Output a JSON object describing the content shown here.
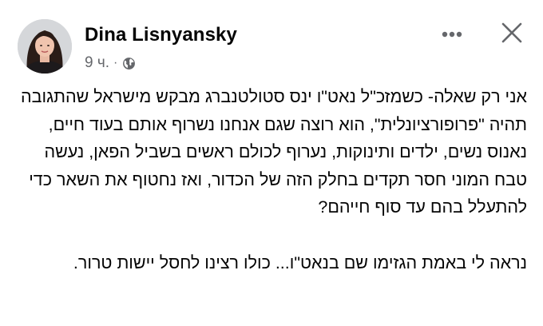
{
  "post": {
    "author": "Dina Lisnyansky",
    "time": "9 ч.",
    "separator": "·",
    "privacy_icon": "globe-icon",
    "menu_icon": "more-horizontal-icon",
    "close_icon": "close-icon",
    "paragraphs": [
      "אני רק שאלה- כשמזכ\"ל נאט\"ו ינס סטולטנברג מבקש מישראל שהתגובה תהיה \"פרופורציונלית\", הוא רוצה שגם אנחנו נשרוף אותם בעוד חיים, נאנוס נשים, ילדים ותינוקות, נערוף לכולם ראשים בשביל הפאן, נעשה טבח המוני חסר תקדים בחלק הזה של הכדור, ואז נחטוף את השאר כדי להתעלל בהם עד סוף חייהם?",
      "נראה לי באמת הגזימו שם בנאט\"ו... כולו רצינו לחסל יישות טרור."
    ]
  },
  "colors": {
    "text_primary": "#050505",
    "text_secondary": "#65676b",
    "background": "#ffffff"
  }
}
